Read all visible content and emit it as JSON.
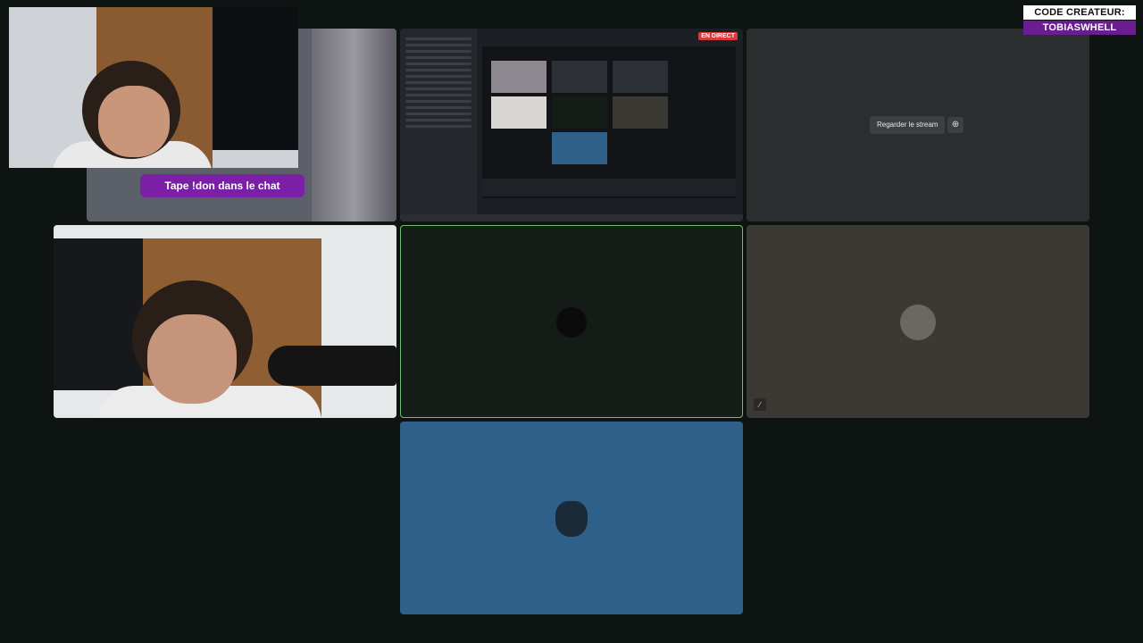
{
  "overlay": {
    "chat_prompt": "Tape !don dans le chat",
    "badge_line1": "CODE CREATEUR:",
    "badge_line2": "TOBIASWHELL"
  },
  "stream_tile": {
    "live_badge": "EN DIRECT"
  },
  "watch_tile": {
    "watch_button": "Regarder le stream",
    "zoom_icon": "magnifier-icon"
  },
  "colors": {
    "active_speaker_border": "#6fbf73",
    "chat_pill": "#7a1fa6",
    "badge_accent": "#6a1d91",
    "blue_tile": "#2f6089"
  }
}
